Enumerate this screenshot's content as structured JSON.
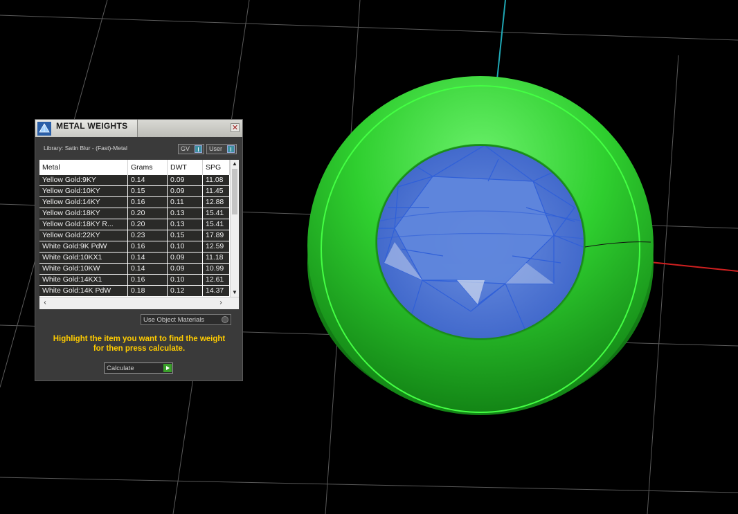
{
  "panel": {
    "title": "METAL WEIGHTS",
    "close_glyph": "✕",
    "library_text": "Library: Satin Blur - (Fast)-Metal",
    "toggle_gv": "GV",
    "toggle_user": "User",
    "columns": [
      "Metal",
      "Grams",
      "DWT",
      "SPG"
    ],
    "rows": [
      [
        "Yellow Gold:9KY",
        "0.14",
        "0.09",
        "11.08"
      ],
      [
        "Yellow Gold:10KY",
        "0.15",
        "0.09",
        "11.45"
      ],
      [
        "Yellow Gold:14KY",
        "0.16",
        "0.11",
        "12.88"
      ],
      [
        "Yellow Gold:18KY",
        "0.20",
        "0.13",
        "15.41"
      ],
      [
        "Yellow Gold:18KY R...",
        "0.20",
        "0.13",
        "15.41"
      ],
      [
        "Yellow Gold:22KY",
        "0.23",
        "0.15",
        "17.89"
      ],
      [
        "White Gold:9K PdW",
        "0.16",
        "0.10",
        "12.59"
      ],
      [
        "White Gold:10KX1",
        "0.14",
        "0.09",
        "11.18"
      ],
      [
        "White Gold:10KW",
        "0.14",
        "0.09",
        "10.99"
      ],
      [
        "White Gold:14KX1",
        "0.16",
        "0.10",
        "12.61"
      ],
      [
        "White Gold:14K PdW",
        "0.18",
        "0.12",
        "14.37"
      ]
    ],
    "use_object_materials": "Use Object Materials",
    "hint_line1": "Highlight the item you want to find the weight",
    "hint_line2": "for then press calculate.",
    "calculate_label": "Calculate"
  },
  "colors": {
    "viewport_bg": "#000000",
    "grid": "#5a5a5a",
    "axis_y": "#1fa6b3",
    "axis_x": "#d02020",
    "ring": "#2fcf2f",
    "gem": "#4a78d8",
    "hint": "#ffcc00"
  },
  "icons": {
    "app": "gem-app-icon",
    "close": "close-icon",
    "scroll_up": "scroll-up-icon",
    "scroll_down": "scroll-down-icon",
    "scroll_left": "scroll-left-icon",
    "scroll_right": "scroll-right-icon",
    "calculate": "play-icon"
  }
}
